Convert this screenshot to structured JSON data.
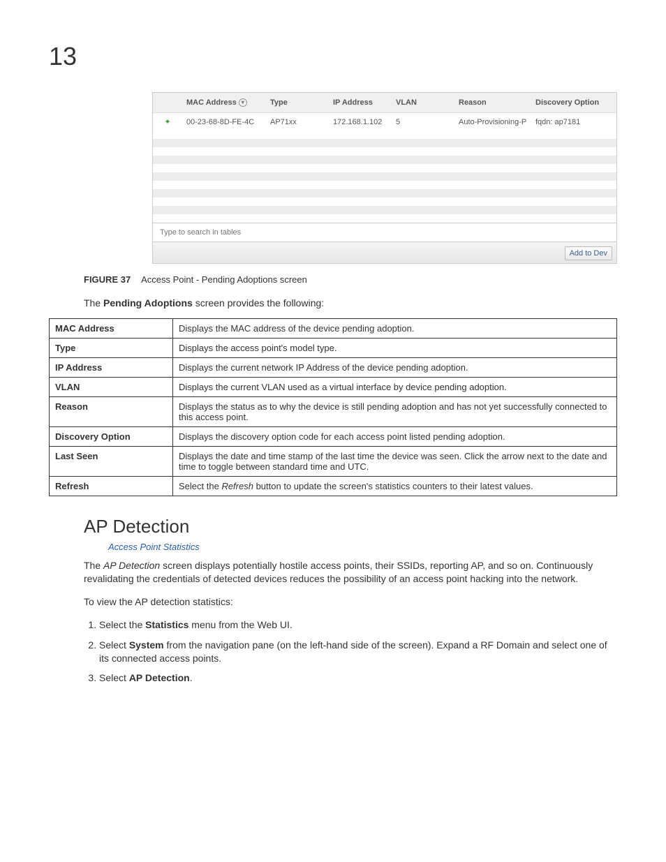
{
  "chapter": "13",
  "screenshot": {
    "headers": {
      "blank": "",
      "mac": "MAC Address",
      "type": "Type",
      "ip": "IP Address",
      "vlan": "VLAN",
      "reason": "Reason",
      "discovery": "Discovery Option"
    },
    "row": {
      "mac": "00-23-68-8D-FE-4C",
      "type": "AP71xx",
      "ip": "172.168.1.102",
      "vlan": "5",
      "reason": "Auto-Provisioning-P",
      "discovery": "fqdn: ap7181"
    },
    "search_placeholder": "Type to search in tables",
    "button": "Add to Dev"
  },
  "figure": {
    "label": "FIGURE 37",
    "caption": "Access Point - Pending Adoptions screen"
  },
  "lead_intro_1": "The ",
  "lead_intro_b": "Pending Adoptions",
  "lead_intro_2": " screen provides the following:",
  "defs": [
    {
      "term": "MAC Address",
      "desc": "Displays the MAC address of the device pending adoption."
    },
    {
      "term": "Type",
      "desc": "Displays the access point's model type."
    },
    {
      "term": "IP Address",
      "desc": "Displays the current network IP Address of the device pending adoption."
    },
    {
      "term": "VLAN",
      "desc": "Displays the current VLAN used as a virtual interface by device pending adoption."
    },
    {
      "term": "Reason",
      "desc": "Displays the status as to why the device is still pending adoption and has not yet successfully connected to this access point."
    },
    {
      "term": "Discovery Option",
      "desc": "Displays the discovery option code for each access point listed pending adoption."
    },
    {
      "term": "Last Seen",
      "desc": "Displays the date and time stamp of the last time the device was seen. Click the arrow next to the date and time to toggle between standard time and UTC."
    },
    {
      "term": "Refresh",
      "desc_pre": "Select the ",
      "desc_i": "Refresh",
      "desc_post": " button to update the screen's statistics counters to their latest values."
    }
  ],
  "section_title": "AP Detection",
  "section_link": "Access Point Statistics",
  "section_body_1a": "The ",
  "section_body_1i": "AP Detection",
  "section_body_1b": " screen displays potentially hostile access points, their SSIDs, reporting AP, and so on. Continuously revalidating the credentials of detected devices reduces the possibility of an access point hacking into the network.",
  "section_body_2": "To view the AP detection statistics:",
  "steps": {
    "s1a": "Select the ",
    "s1b": "Statistics",
    "s1c": " menu from the Web UI.",
    "s2a": "Select ",
    "s2b": "System",
    "s2c": " from the navigation pane (on the left-hand side of the screen). Expand a RF Domain and select one of its connected access points.",
    "s3a": "Select ",
    "s3b": "AP Detection",
    "s3c": "."
  }
}
